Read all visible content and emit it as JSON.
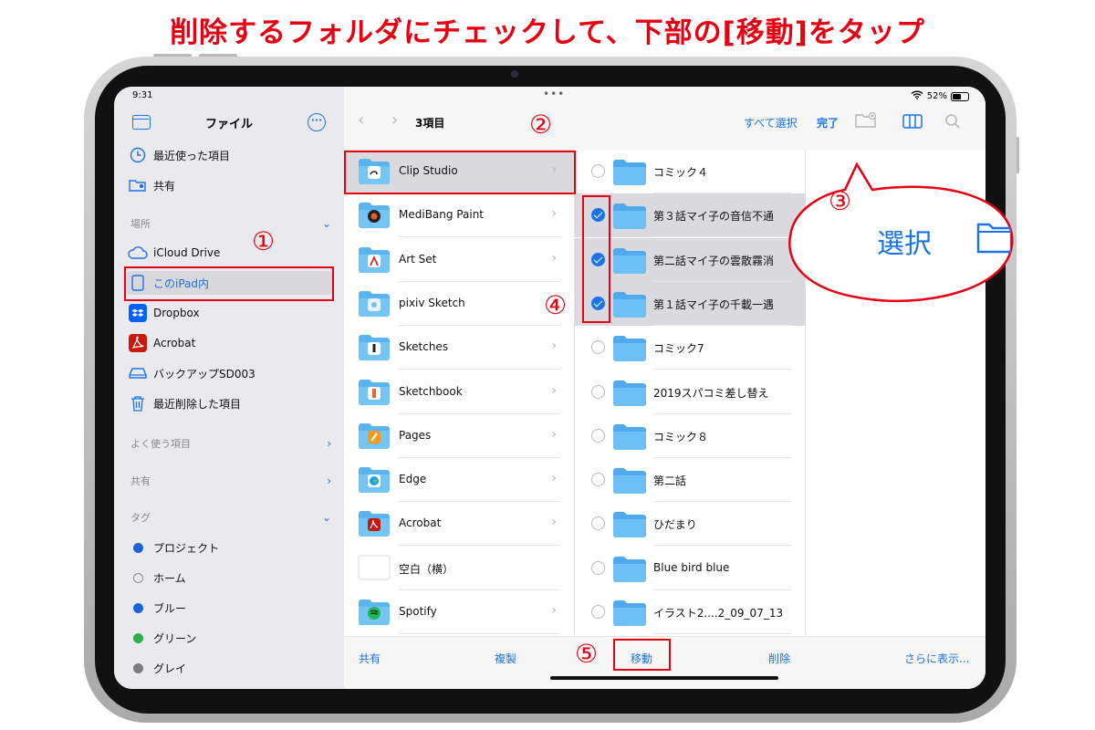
{
  "headline": "削除するフォルダにチェックして、下部の[移動]をタップ",
  "status": {
    "time": "9:31",
    "battery": "52%"
  },
  "sidebar": {
    "title": "ファイル",
    "recents": [
      {
        "label": "最近使った項目",
        "icon": "clock-icon"
      },
      {
        "label": "共有",
        "icon": "shared-folder-icon"
      }
    ],
    "locations_header": "場所",
    "locations": [
      {
        "label": "iCloud Drive",
        "icon": "cloud-icon",
        "selected": false
      },
      {
        "label": "このiPad内",
        "icon": "ipad-icon",
        "selected": true
      },
      {
        "label": "Dropbox",
        "icon": "dropbox-icon",
        "selected": false
      },
      {
        "label": "Acrobat",
        "icon": "acrobat-icon",
        "selected": false
      },
      {
        "label": "バックアップSD003",
        "icon": "drive-icon",
        "selected": false
      },
      {
        "label": "最近削除した項目",
        "icon": "trash-icon",
        "selected": false
      }
    ],
    "favorites_header": "よく使う項目",
    "shared_header": "共有",
    "tags_header": "タグ",
    "tags": [
      {
        "label": "プロジェクト",
        "color": "#1a62d6"
      },
      {
        "label": "ホーム",
        "color": "none"
      },
      {
        "label": "ブルー",
        "color": "#1a62d6"
      },
      {
        "label": "グリーン",
        "color": "#2fae4e"
      },
      {
        "label": "グレイ",
        "color": "#7c7c80"
      }
    ]
  },
  "toolbar": {
    "breadcrumb": "3項目",
    "select_all": "すべて選択",
    "done": "完了"
  },
  "apps_column": [
    {
      "label": "Clip Studio",
      "icon": "clip-studio-icon",
      "selected": true,
      "chevron": true
    },
    {
      "label": "MediBang Paint",
      "icon": "medibang-icon",
      "selected": false,
      "chevron": true
    },
    {
      "label": "Art Set",
      "icon": "art-set-icon",
      "selected": false,
      "chevron": true
    },
    {
      "label": "pixiv Sketch",
      "icon": "pixiv-sketch-icon",
      "selected": false,
      "chevron": true
    },
    {
      "label": "Sketches",
      "icon": "sketches-icon",
      "selected": false,
      "chevron": true
    },
    {
      "label": "Sketchbook",
      "icon": "sketchbook-icon",
      "selected": false,
      "chevron": true
    },
    {
      "label": "Pages",
      "icon": "pages-icon",
      "selected": false,
      "chevron": true
    },
    {
      "label": "Edge",
      "icon": "edge-icon",
      "selected": false,
      "chevron": true
    },
    {
      "label": "Acrobat",
      "icon": "acrobat-icon",
      "selected": false,
      "chevron": true
    },
    {
      "label": "空白（横）",
      "icon": "blank-document-icon",
      "selected": false,
      "chevron": false
    },
    {
      "label": "Spotify",
      "icon": "spotify-icon",
      "selected": false,
      "chevron": true
    }
  ],
  "folders_column": [
    {
      "label": "コミック４",
      "checked": false
    },
    {
      "label": "第３話マイ子の音信不通",
      "checked": true
    },
    {
      "label": "第二話マイ子の雲散霧消",
      "checked": true
    },
    {
      "label": "第１話マイ子の千載一遇",
      "checked": true
    },
    {
      "label": "コミック7",
      "checked": false
    },
    {
      "label": "2019スパコミ差し替え",
      "checked": false
    },
    {
      "label": "コミック８",
      "checked": false
    },
    {
      "label": "第二話",
      "checked": false
    },
    {
      "label": "ひだまり",
      "checked": false
    },
    {
      "label": "Blue bird blue",
      "checked": false
    },
    {
      "label": "イラスト2....2_09_07_13",
      "checked": false
    }
  ],
  "bottombar": {
    "share": "共有",
    "duplicate": "複製",
    "move": "移動",
    "delete": "削除",
    "more": "さらに表示..."
  },
  "callout": {
    "label": "選択"
  },
  "annotations": {
    "n1": "①",
    "n2": "②",
    "n3": "③",
    "n4": "④",
    "n5": "⑤"
  },
  "colors": {
    "accent": "#1a73e8",
    "annotation_red": "#e60012",
    "folder_blue": "#5ab4f0"
  }
}
